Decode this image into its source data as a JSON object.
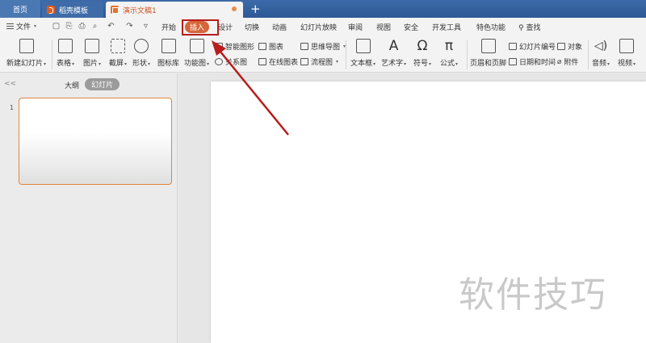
{
  "tabs": {
    "home": "首页",
    "template": "稻壳模板",
    "document": "演示文稿1",
    "new_tab": "+"
  },
  "menubar": {
    "file": "文件",
    "file_caret": "▾",
    "items": [
      "开始",
      "插入",
      "设计",
      "切换",
      "动画",
      "幻灯片放映",
      "审阅",
      "视图",
      "安全",
      "开发工具",
      "特色功能",
      "查找"
    ],
    "active_index": 1
  },
  "ribbon": {
    "new_slide": "新建幻灯片",
    "table": "表格",
    "picture": "图片",
    "screenshot": "截屏",
    "shape": "形状",
    "icon_lib": "图标库",
    "function_chart": "功能图",
    "smart_graphic": "智能图形",
    "chart": "图表",
    "mind_map": "思维导图",
    "relation_chart": "关系图",
    "online_chart": "在线图表",
    "flowchart": "流程图",
    "textbox": "文本框",
    "art_text": "艺术字",
    "symbol": "符号",
    "formula": "公式",
    "header_footer": "页眉和页脚",
    "slide_number": "幻灯片编号",
    "object": "对象",
    "date_time": "日期和时间",
    "attachment": "附件",
    "audio": "音频",
    "video": "视频",
    "caret": "▾"
  },
  "left_panel": {
    "collapse": "<<",
    "outline_tab": "大纲",
    "slides_tab": "幻灯片",
    "slide_number": "1"
  },
  "watermark": "软件技巧",
  "colors": {
    "accent": "#d6663a",
    "highlight_border": "#b81c1c",
    "tabbar": "#2d5a96"
  }
}
